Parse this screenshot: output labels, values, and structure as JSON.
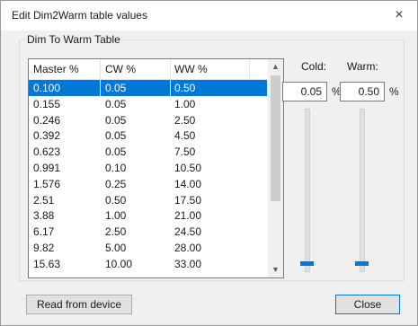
{
  "window": {
    "title": "Edit Dim2Warm table values",
    "close_glyph": "×"
  },
  "group": {
    "label": "Dim To Warm Table"
  },
  "table": {
    "headers": [
      "Master %",
      "CW %",
      "WW %"
    ],
    "rows": [
      [
        "0.100",
        "0.05",
        "0.50"
      ],
      [
        "0.155",
        "0.05",
        "1.00"
      ],
      [
        "0.246",
        "0.05",
        "2.50"
      ],
      [
        "0.392",
        "0.05",
        "4.50"
      ],
      [
        "0.623",
        "0.05",
        "7.50"
      ],
      [
        "0.991",
        "0.10",
        "10.50"
      ],
      [
        "1.576",
        "0.25",
        "14.00"
      ],
      [
        "2.51",
        "0.50",
        "17.50"
      ],
      [
        "3.88",
        "1.00",
        "21.00"
      ],
      [
        "6.17",
        "2.50",
        "24.50"
      ],
      [
        "9.82",
        "5.00",
        "28.00"
      ],
      [
        "15.63",
        "10.00",
        "33.00"
      ]
    ],
    "selected_row": 0,
    "scroll_up_glyph": "▲",
    "scroll_down_glyph": "▼"
  },
  "cold": {
    "label": "Cold:",
    "value": "0.05",
    "unit": "%",
    "slider_level": 0.0
  },
  "warm": {
    "label": "Warm:",
    "value": "0.50",
    "unit": "%",
    "slider_level": 0.0
  },
  "buttons": {
    "read_from_device": "Read from device",
    "close": "Close"
  },
  "colors": {
    "accent": "#0078d7",
    "dialog_bg": "#f0f0f0"
  }
}
